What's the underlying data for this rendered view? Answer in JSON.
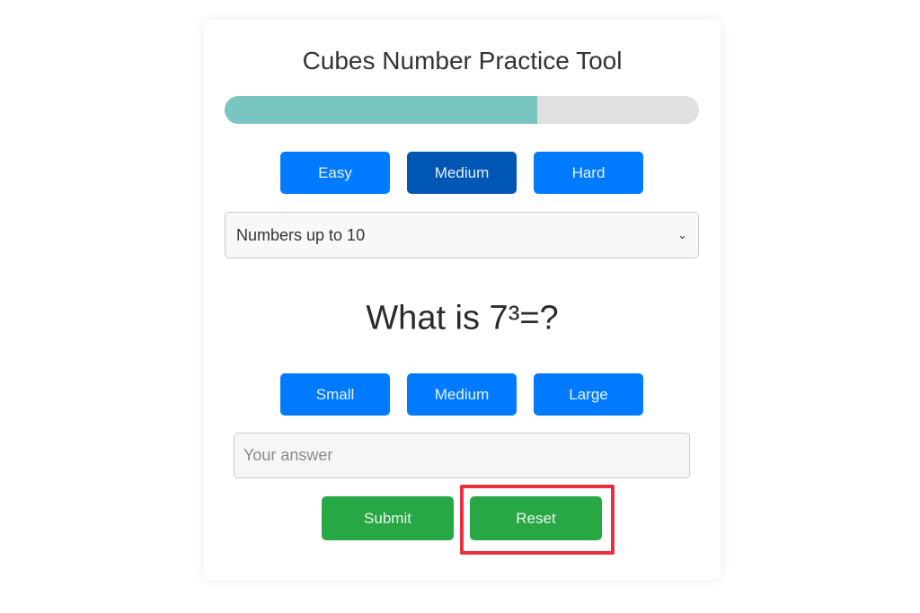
{
  "app": {
    "title": "Cubes Number Practice Tool"
  },
  "progress": {
    "fraction": 0.66,
    "fill_color": "#78c6bf",
    "track_color": "#e0e0e0"
  },
  "difficulty": {
    "options": [
      {
        "label": "Easy",
        "active": false
      },
      {
        "label": "Medium",
        "active": true
      },
      {
        "label": "Hard",
        "active": false
      }
    ]
  },
  "range_select": {
    "selected": "Numbers up to 10",
    "icon": "chevron-down-icon"
  },
  "question": {
    "text": "What is 7³=?"
  },
  "size_buttons": {
    "options": [
      {
        "label": "Small"
      },
      {
        "label": "Medium"
      },
      {
        "label": "Large"
      }
    ]
  },
  "answer_input": {
    "value": "",
    "placeholder": "Your answer"
  },
  "actions": {
    "submit_label": "Submit",
    "reset_label": "Reset"
  },
  "colors": {
    "primary_blue": "#007bff",
    "active_blue": "#0056b3",
    "green": "#28a745",
    "highlight_red": "#e8303f"
  }
}
